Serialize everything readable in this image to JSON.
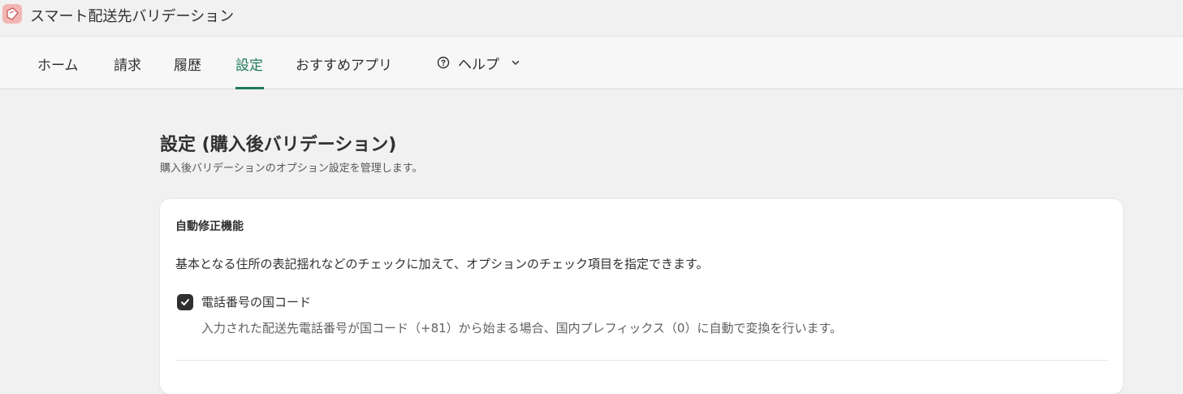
{
  "app": {
    "title": "スマート配送先バリデーション",
    "icon": "app-logo-icon",
    "icon_bg": "#f2b6b3"
  },
  "nav": {
    "items": [
      {
        "label": "ホーム",
        "active": false
      },
      {
        "label": "請求",
        "active": false
      },
      {
        "label": "履歴",
        "active": false
      },
      {
        "label": "設定",
        "active": true
      },
      {
        "label": "おすすめアプリ",
        "active": false
      }
    ],
    "help_label": "ヘルプ",
    "active_color": "#1f7a5a"
  },
  "page": {
    "title": "設定 (購入後バリデーション)",
    "subtitle": "購入後バリデーションのオプション設定を管理します。"
  },
  "card": {
    "heading": "自動修正機能",
    "description": "基本となる住所の表記揺れなどのチェックに加えて、オプションのチェック項目を指定できます。",
    "option": {
      "label": "電話番号の国コード",
      "checked": true,
      "help": "入力された配送先電話番号が国コード（+81）から始まる場合、国内プレフィックス（0）に自動で変換を行います。"
    }
  }
}
